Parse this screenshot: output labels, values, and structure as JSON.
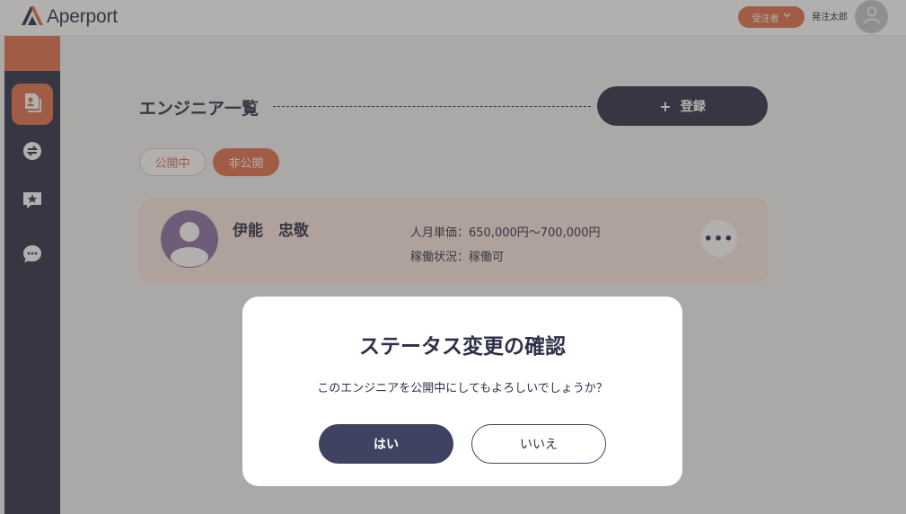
{
  "app": {
    "brand": "Aperport",
    "logo_icon": "aperport-logo-icon",
    "accent_color": "#e36f4b",
    "navy_color": "#2e3048"
  },
  "header": {
    "role_label": "受注者",
    "role_icon": "chevron-down-icon",
    "user_name": "発注太郎",
    "avatar_icon": "user-icon"
  },
  "sidebar": {
    "items": [
      {
        "icon": "engineer-list-icon",
        "active": true
      },
      {
        "icon": "exchange-icon",
        "active": false
      },
      {
        "icon": "star-message-icon",
        "active": false
      },
      {
        "icon": "chat-icon",
        "active": false
      }
    ]
  },
  "main": {
    "title": "エンジニア一覧",
    "register_button": {
      "icon": "+",
      "label": "登録"
    },
    "tabs": [
      {
        "label": "公開中",
        "active": false
      },
      {
        "label": "非公開",
        "active": true
      }
    ],
    "engineers": [
      {
        "name": "伊能　忠敬",
        "rate": "人月単価：650,000円〜700,000円",
        "status": "稼働状況：稼働可",
        "more_icon": "•••"
      }
    ]
  },
  "modal": {
    "title": "ステータス変更の確認",
    "message": "このエンジニアを公開中にしてもよろしいでしょうか？",
    "confirm_label": "はい",
    "cancel_label": "いいえ"
  }
}
